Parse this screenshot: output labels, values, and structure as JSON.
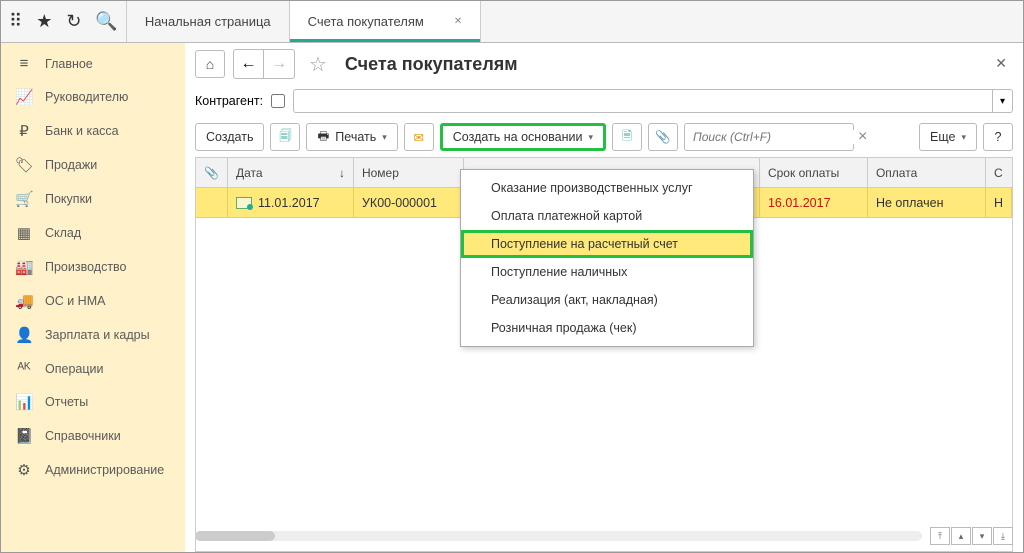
{
  "tabs": {
    "start": "Начальная страница",
    "active": "Счета покупателям"
  },
  "sidebar": [
    {
      "icon": "≡",
      "label": "Главное"
    },
    {
      "icon": "📈",
      "label": "Руководителю"
    },
    {
      "icon": "₽",
      "label": "Банк и касса"
    },
    {
      "icon": "🏷",
      "label": "Продажи"
    },
    {
      "icon": "🛒",
      "label": "Покупки"
    },
    {
      "icon": "▦",
      "label": "Склад"
    },
    {
      "icon": "🏭",
      "label": "Производство"
    },
    {
      "icon": "🚚",
      "label": "ОС и НМА"
    },
    {
      "icon": "👤",
      "label": "Зарплата и кадры"
    },
    {
      "icon": "ᴬᴷ",
      "label": "Операции"
    },
    {
      "icon": "📊",
      "label": "Отчеты"
    },
    {
      "icon": "📓",
      "label": "Справочники"
    },
    {
      "icon": "⚙",
      "label": "Администрирование"
    }
  ],
  "page_title": "Счета покупателям",
  "filter_label": "Контрагент:",
  "toolbar": {
    "create": "Создать",
    "print": "Печать",
    "create_based": "Создать на основании",
    "search_ph": "Поиск (Ctrl+F)",
    "more": "Еще"
  },
  "columns": {
    "pin": "📎",
    "date": "Дата",
    "number": "Номер",
    "due": "Срок оплаты",
    "payment": "Оплата",
    "last": "С"
  },
  "row": {
    "date": "11.01.2017",
    "number": "УК00-000001",
    "due": "16.01.2017",
    "payment": "Не оплачен",
    "last": "Н"
  },
  "menu": [
    "Оказание производственных услуг",
    "Оплата платежной картой",
    "Поступление на расчетный счет",
    "Поступление наличных",
    "Реализация (акт, накладная)",
    "Розничная продажа (чек)"
  ]
}
